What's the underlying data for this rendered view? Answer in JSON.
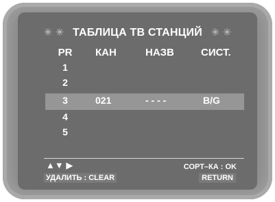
{
  "title": {
    "left_decor": "✳ ✳",
    "text": "ТАБЛИЦА ТВ СТАНЦИЙ",
    "right_decor": "✳ ✳"
  },
  "columns": {
    "pr": "PR",
    "channel": "КАН",
    "name": "НАЗВ",
    "system": "СИСТ."
  },
  "rows": [
    {
      "pr": "1",
      "channel": "",
      "name": "",
      "system": ""
    },
    {
      "pr": "2",
      "channel": "",
      "name": "",
      "system": ""
    },
    {
      "pr": "3",
      "channel": "021",
      "name": "- - - -",
      "system": "B/G"
    },
    {
      "pr": "4",
      "channel": "",
      "name": "",
      "system": ""
    },
    {
      "pr": "5",
      "channel": "",
      "name": "",
      "system": ""
    }
  ],
  "selected_row": 2,
  "footer": {
    "nav_arrows": "▲▼ ▶",
    "delete_label": "УДАЛИТЬ : CLEAR",
    "sort_label": "СОРТ–КА : OK",
    "return_label": "RETURN"
  },
  "colors": {
    "screen_bg": "#6c6c6c",
    "highlight_bg": "#969696",
    "text": "#ffffff"
  }
}
